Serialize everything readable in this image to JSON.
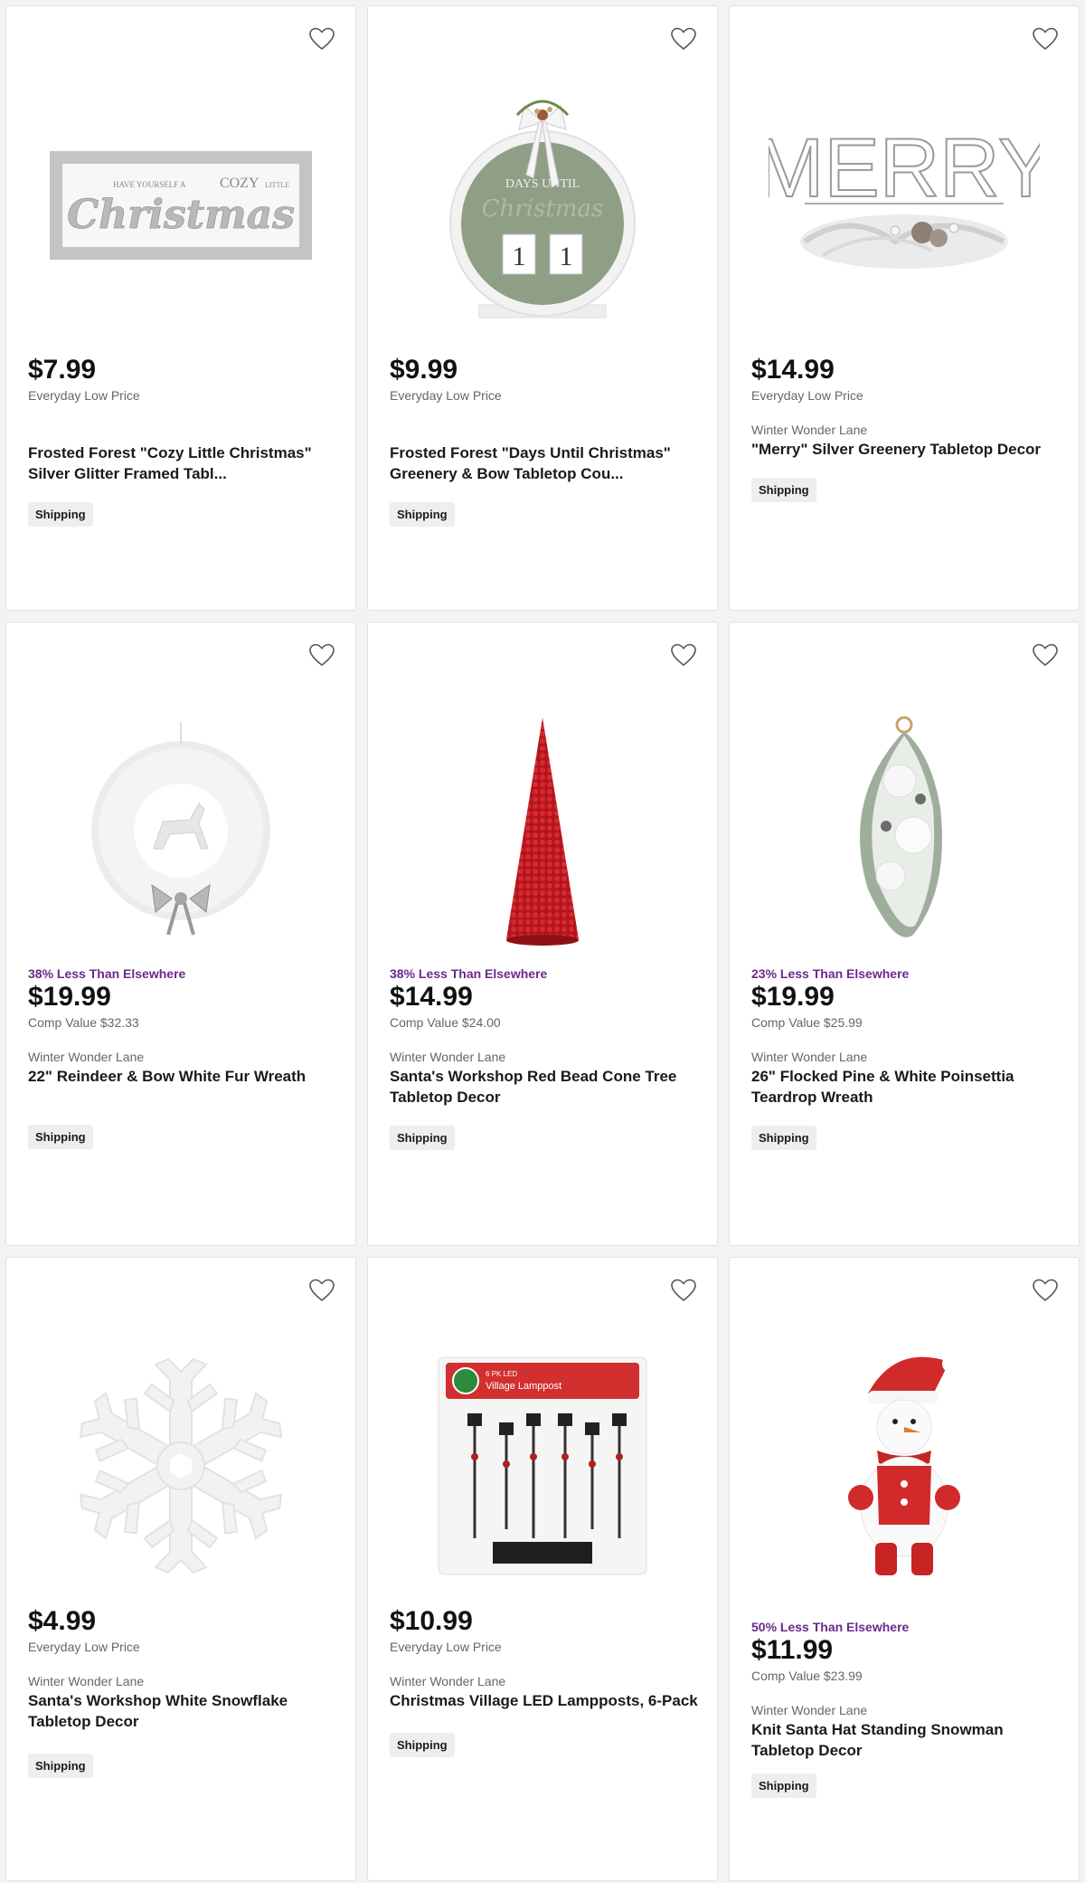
{
  "products": [
    {
      "discount": "",
      "price": "$7.99",
      "sub": "Everyday Low Price",
      "brand": "",
      "name": "Frosted Forest \"Cozy Little Christmas\" Silver Glitter Framed Tabl...",
      "shipping": "Shipping",
      "image_text": {
        "line1": "HAVE YOURSELF A",
        "cozy": "COZY",
        "little": "LITTLE",
        "word": "Christmas"
      }
    },
    {
      "discount": "",
      "price": "$9.99",
      "sub": "Everyday Low Price",
      "brand": "",
      "name": "Frosted Forest \"Days Until Christmas\" Greenery & Bow Tabletop Cou...",
      "shipping": "Shipping",
      "image_text": {
        "line1": "DAYS UNTIL",
        "word": "Christmas",
        "d1": "1",
        "d2": "1"
      }
    },
    {
      "discount": "",
      "price": "$14.99",
      "sub": "Everyday Low Price",
      "brand": "Winter Wonder Lane",
      "name": "\"Merry\" Silver Greenery Tabletop Decor",
      "shipping": "Shipping",
      "image_text": {
        "word": "MERRY"
      }
    },
    {
      "discount": "38% Less Than Elsewhere",
      "price": "$19.99",
      "sub": "Comp Value $32.33",
      "brand": "Winter Wonder Lane",
      "name": "22\" Reindeer & Bow White Fur Wreath",
      "shipping": "Shipping"
    },
    {
      "discount": "38% Less Than Elsewhere",
      "price": "$14.99",
      "sub": "Comp Value $24.00",
      "brand": "Winter Wonder Lane",
      "name": "Santa's Workshop Red Bead Cone Tree Tabletop Decor",
      "shipping": "Shipping"
    },
    {
      "discount": "23% Less Than Elsewhere",
      "price": "$19.99",
      "sub": "Comp Value $25.99",
      "brand": "Winter Wonder Lane",
      "name": "26\" Flocked Pine & White Poinsettia Teardrop Wreath",
      "shipping": "Shipping"
    },
    {
      "discount": "",
      "price": "$4.99",
      "sub": "Everyday Low Price",
      "brand": "Winter Wonder Lane",
      "name": "Santa's Workshop White Snowflake Tabletop Decor",
      "shipping": "Shipping"
    },
    {
      "discount": "",
      "price": "$10.99",
      "sub": "Everyday Low Price",
      "brand": "Winter Wonder Lane",
      "name": "Christmas Village LED Lampposts, 6-Pack",
      "shipping": "Shipping",
      "image_text": {
        "pack": "6 PK LED",
        "title": "Village Lamppost"
      }
    },
    {
      "discount": "50% Less Than Elsewhere",
      "price": "$11.99",
      "sub": "Comp Value $23.99",
      "brand": "Winter Wonder Lane",
      "name": "Knit Santa Hat Standing Snowman Tabletop Decor",
      "shipping": "Shipping"
    }
  ],
  "icons": {
    "favorite": "heart-outline-icon"
  },
  "colors": {
    "discount": "#6b2a8c",
    "price": "#111111",
    "shipping_bg": "#eeeeee"
  }
}
